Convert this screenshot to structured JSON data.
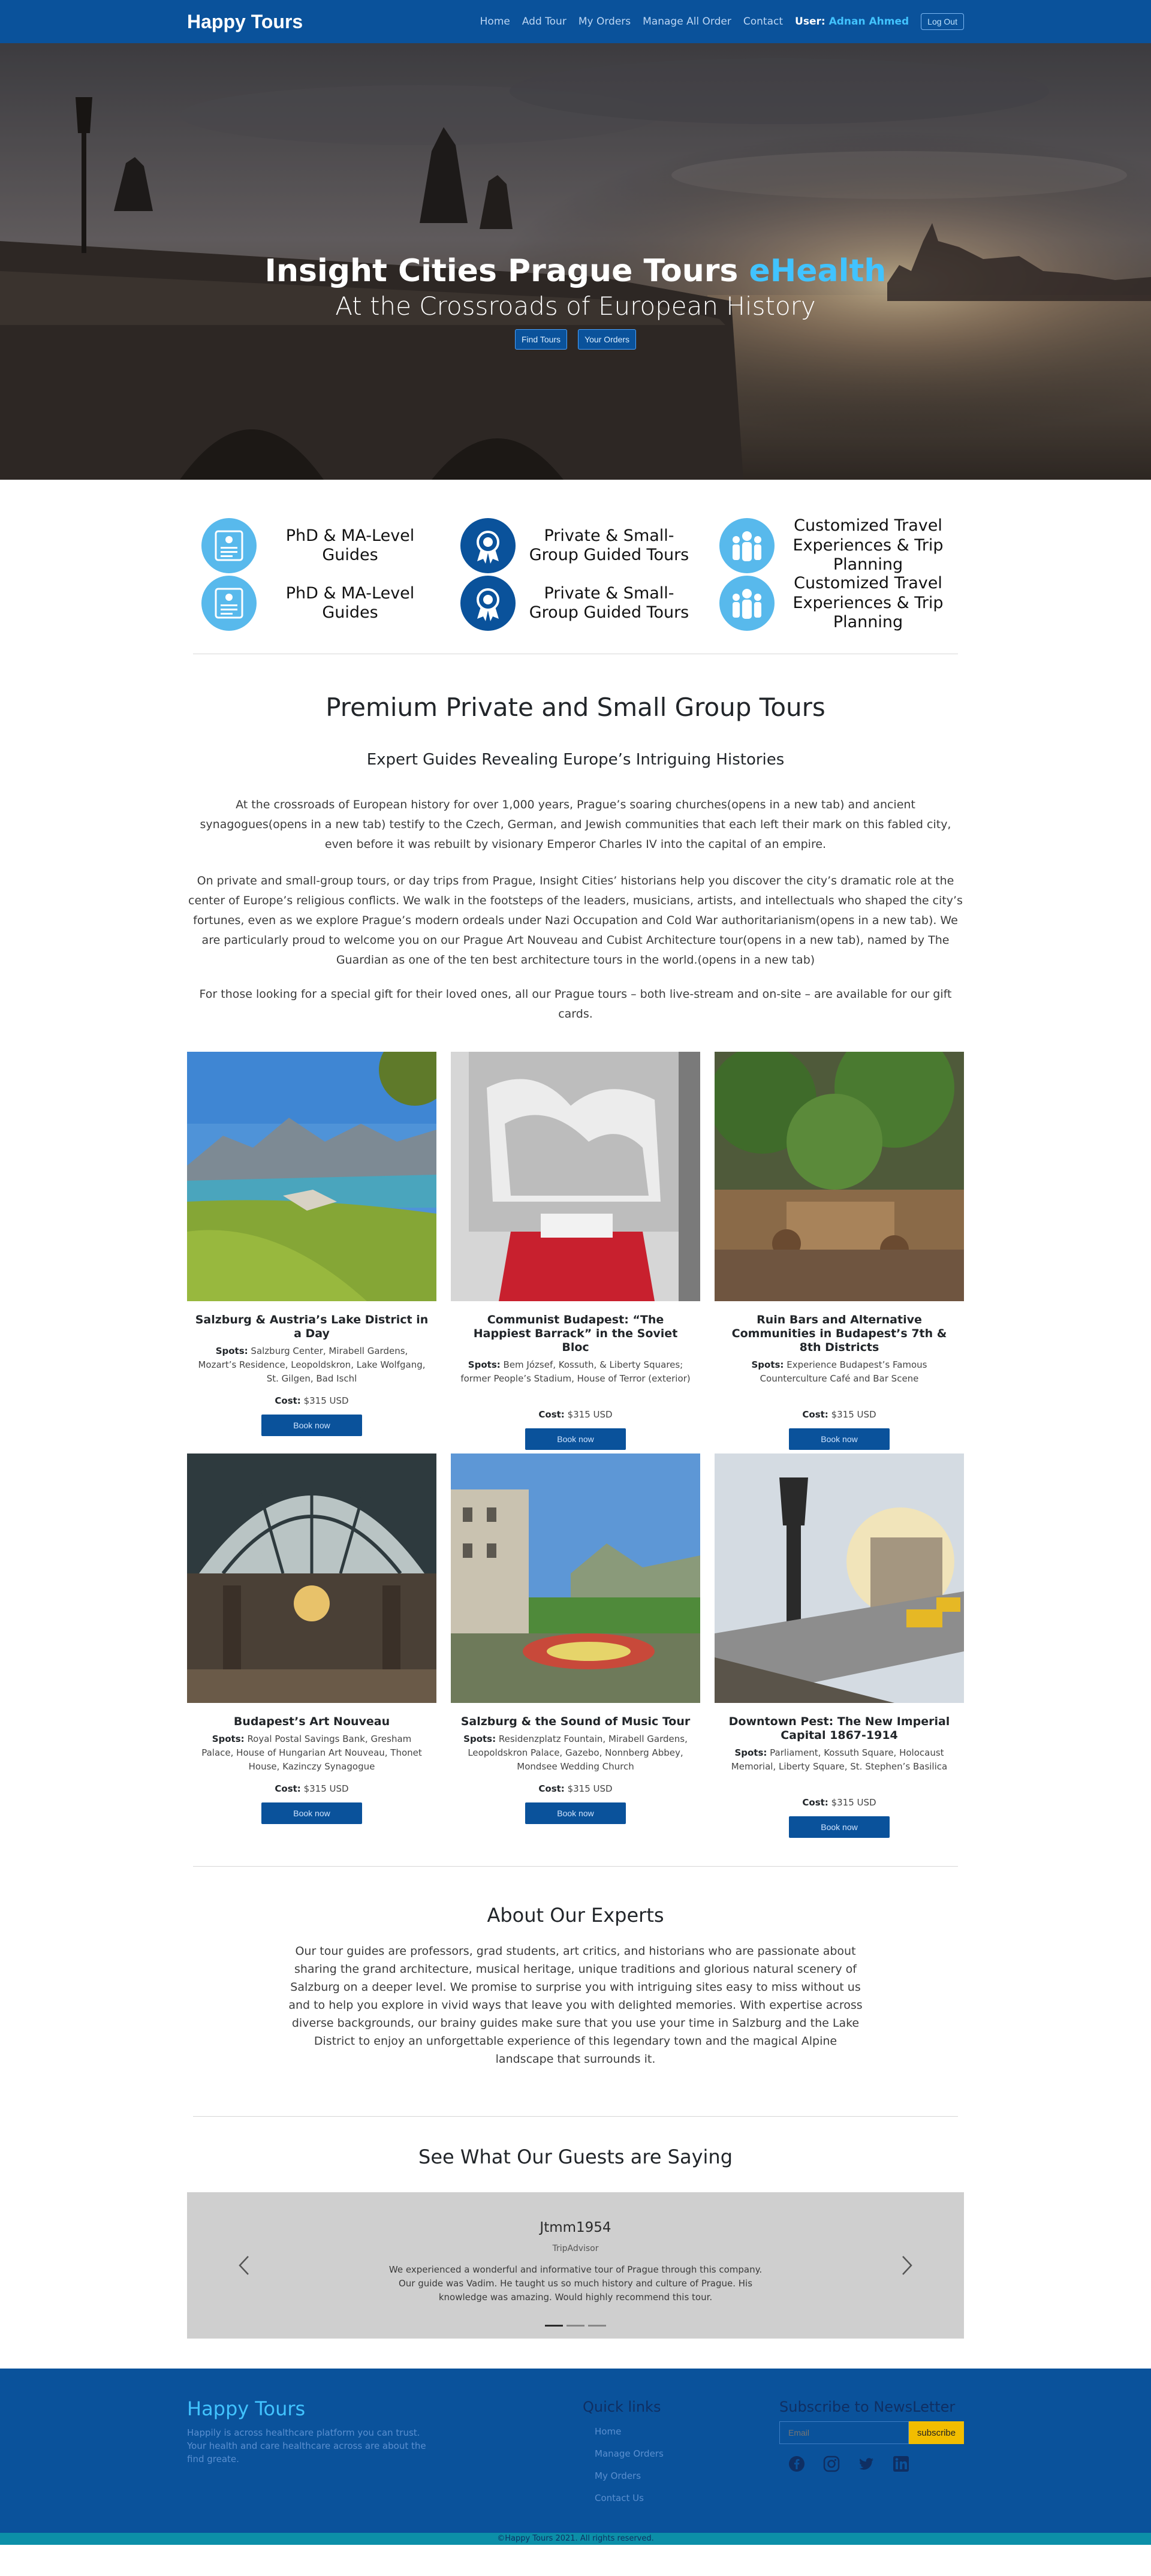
{
  "nav": {
    "brand": "Happy Tours",
    "links": [
      "Home",
      "Add Tour",
      "My Orders",
      "Manage All Order",
      "Contact"
    ],
    "user_prefix": "User:",
    "user_name": "Adnan Ahmed",
    "logout": "Log Out"
  },
  "hero": {
    "title": "Insight Cities Prague Tours",
    "title_accent": "eHealth",
    "subtitle": "At the Crossroads of European History",
    "btn_find": "Find Tours",
    "btn_orders": "Your Orders"
  },
  "features": [
    {
      "label": "PhD & MA-Level Guides",
      "icon": "guide-badge-icon"
    },
    {
      "label": "Private & Small-Group Guided Tours",
      "icon": "award-ribbon-icon"
    },
    {
      "label": "Customized Travel Experiences & Trip Planning",
      "icon": "group-people-icon"
    },
    {
      "label": "PhD & MA-Level Guides",
      "icon": "guide-badge-icon"
    },
    {
      "label": "Private & Small-Group Guided Tours",
      "icon": "award-ribbon-icon"
    },
    {
      "label": "Customized Travel Experiences & Trip Planning",
      "icon": "group-people-icon"
    }
  ],
  "intro": {
    "title": "Premium Private and Small Group Tours",
    "subtitle": "Expert Guides Revealing Europe’s Intriguing Histories",
    "p1": "At the crossroads of European history for over 1,000 years, Prague’s soaring churches(opens in a new tab) and ancient synagogues(opens in a new tab) testify to the Czech, German, and Jewish communities that each left their mark on this fabled city, even before it was rebuilt by visionary Emperor Charles IV into the capital of an empire.",
    "p2": "On private and small-group tours, or day trips from Prague, Insight Cities’ historians help you discover the city’s dramatic role at the center of Europe’s religious conflicts. We walk in the footsteps of the leaders, musicians, artists, and intellectuals who shaped the city’s fortunes, even as we explore Prague’s modern ordeals under Nazi Occupation and Cold War authoritarianism(opens in a new tab). We are particularly proud to welcome you on our Prague Art Nouveau and Cubist Architecture tour(opens in a new tab), named by The Guardian as one of the ten best architecture tours in the world.(opens in a new tab)",
    "p3": "For those looking for a special gift for their loved ones, all our Prague tours – both live-stream and on-site – are available for our gift cards."
  },
  "tours": [
    {
      "title": "Salzburg & Austria’s Lake District in a Day",
      "spots_label": "Spots:",
      "spots": "Salzburg Center, Mirabell Gardens, Mozart’s Residence, Leopoldskron, Lake Wolfgang, St. Gilgen, Bad Ischl",
      "cost_label": "Cost:",
      "cost": "$315 USD",
      "btn": "Book now"
    },
    {
      "title": "Communist Budapest: “The Happiest Barrack” in the Soviet Bloc",
      "spots_label": "Spots:",
      "spots": "Bem József, Kossuth, & Liberty Squares; former People’s Stadium, House of Terror (exterior)",
      "cost_label": "Cost:",
      "cost": "$315 USD",
      "btn": "Book now"
    },
    {
      "title": "Ruin Bars and Alternative Communities in Budapest’s 7th & 8th Districts",
      "spots_label": "Spots:",
      "spots": "Experience Budapest’s Famous Counterculture Café and Bar Scene",
      "cost_label": "Cost:",
      "cost": "$315 USD",
      "btn": "Book now"
    },
    {
      "title": "Budapest’s Art Nouveau",
      "spots_label": "Spots:",
      "spots": "Royal Postal Savings Bank, Gresham Palace, House of Hungarian Art Nouveau, Thonet House, Kazinczy Synagogue",
      "cost_label": "Cost:",
      "cost": "$315 USD",
      "btn": "Book now"
    },
    {
      "title": "Salzburg & the Sound of Music Tour",
      "spots_label": "Spots:",
      "spots": "Residenzplatz Fountain, Mirabell Gardens, Leopoldskron Palace, Gazebo, Nonnberg Abbey, Mondsee Wedding Church",
      "cost_label": "Cost:",
      "cost": "$315 USD",
      "btn": "Book now"
    },
    {
      "title": "Downtown Pest: The New Imperial Capital 1867-1914",
      "spots_label": "Spots:",
      "spots": "Parliament, Kossuth Square, Holocaust Memorial, Liberty Square, St. Stephen’s Basilica",
      "cost_label": "Cost:",
      "cost": "$315 USD",
      "btn": "Book now"
    }
  ],
  "about": {
    "title": "About Our Experts",
    "text": "Our tour guides are professors, grad students, art critics, and historians who are passionate about sharing the grand architecture, musical heritage, unique traditions and glorious natural scenery of Salzburg on a deeper level. We promise to surprise you with intriguing sites easy to miss without us and to help you explore in vivid ways that leave you with delighted memories. With expertise across diverse backgrounds, our brainy guides make sure that you use your time in Salzburg and the Lake District to enjoy an unforgettable experience of this legendary town and the magical Alpine landscape that surrounds it."
  },
  "testimonials": {
    "title": "See What Our Guests are Saying",
    "name": "Jtmm1954",
    "source": "TripAdvisor",
    "text": "We experienced a wonderful and informative tour of Prague through this company. Our guide was Vadim. He taught us so much history and culture of Prague. His knowledge was amazing. Would highly recommend this tour.",
    "slides": 3,
    "active": 0
  },
  "footer": {
    "brand": "Happy Tours",
    "desc": "Happily is across healthcare platform you can trust. Your health and care healthcare across are about the find greate.",
    "quick_title": "Quick links",
    "quick_links": [
      "Home",
      "Manage Orders",
      "My Orders",
      "Contact Us"
    ],
    "news_title": "Subscribe to NewsLetter",
    "email_placeholder": "Email",
    "subscribe": "subscribe",
    "social": [
      "facebook-icon",
      "instagram-icon",
      "twitter-icon",
      "linkedin-icon"
    ],
    "copyright": "©Happy Tours 2021. All rights reserved."
  },
  "colors": {
    "primary": "#0a529b",
    "accent": "#41c3ff",
    "feature_light": "#58b9ec",
    "subscribe": "#f2bd00",
    "copyright_bar": "#0c8fa8"
  }
}
